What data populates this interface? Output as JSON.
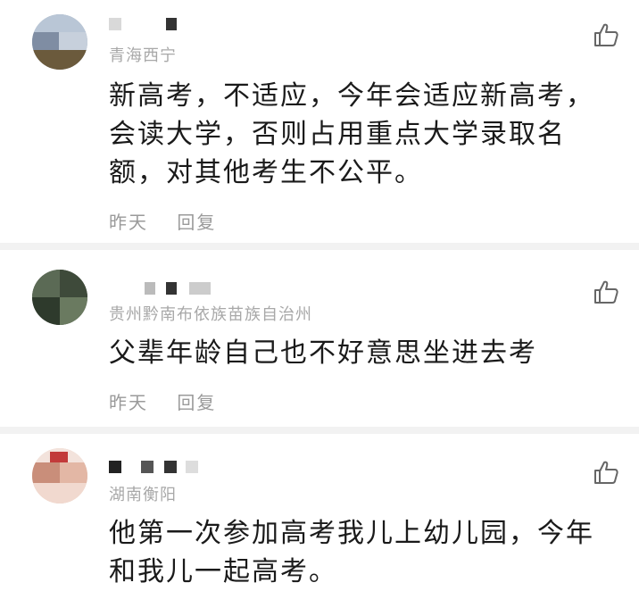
{
  "comments": [
    {
      "location": "青海西宁",
      "text": "新高考，不适应，今年会适应新高考，会读大学，否则占用重点大学录取名额，对其他考生不公平。",
      "time": "昨天",
      "reply_label": "回复",
      "like_icon": "thumbs-up-icon"
    },
    {
      "location": "贵州黔南布依族苗族自治州",
      "text": "父辈年龄自己也不好意思坐进去考",
      "time": "昨天",
      "reply_label": "回复",
      "like_icon": "thumbs-up-icon"
    },
    {
      "location": "湖南衡阳",
      "text": "他第一次参加高考我儿上幼儿园，今年和我儿一起高考。",
      "like_icon": "thumbs-up-icon"
    }
  ],
  "colors": {
    "text": "#1a1a1a",
    "meta": "#9a9a9a",
    "divider": "#f2f2f2"
  }
}
